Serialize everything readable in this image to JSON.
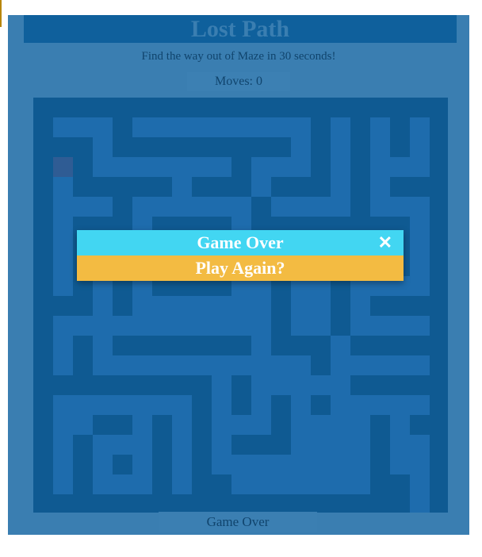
{
  "app": {
    "title": "Lost Path",
    "subtitle": "Find the way out of Maze in 30 seconds!",
    "moves": "Moves: 0",
    "status": "Game Over"
  },
  "modal": {
    "title": "Game Over",
    "close_symbol": "✕",
    "close_icon": "close-icon",
    "action_label": "Play Again?"
  },
  "colors": {
    "page_bg": "#3a7eb1",
    "wall": "#0f5a92",
    "path": "#1e6cad",
    "player": "#2f5c94",
    "modal_header": "#42d6f2",
    "modal_button": "#f3bb42"
  }
}
